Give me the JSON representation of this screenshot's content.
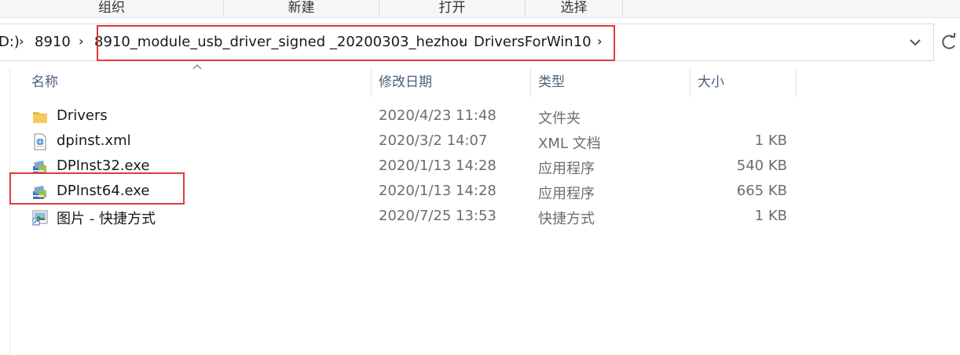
{
  "ribbon": {
    "groups": [
      "组织",
      "新建",
      "打开",
      "选择"
    ]
  },
  "address": {
    "prefix": "D:)",
    "crumbs": [
      "8910",
      "8910_module_usb_driver_signed _20200303_hezhou",
      "DriversForWin10"
    ]
  },
  "columns": {
    "name": "名称",
    "date": "修改日期",
    "type": "类型",
    "size": "大小"
  },
  "files": [
    {
      "name": "Drivers",
      "date": "2020/4/23 11:48",
      "type": "文件夹",
      "size": "",
      "icon": "folder-icon"
    },
    {
      "name": "dpinst.xml",
      "date": "2020/3/2 14:07",
      "type": "XML 文档",
      "size": "1 KB",
      "icon": "xml-document-icon"
    },
    {
      "name": "DPInst32.exe",
      "date": "2020/1/13 14:28",
      "type": "应用程序",
      "size": "540 KB",
      "icon": "installer-app-icon"
    },
    {
      "name": "DPInst64.exe",
      "date": "2020/1/13 14:28",
      "type": "应用程序",
      "size": "665 KB",
      "icon": "installer-app-icon"
    },
    {
      "name": "图片 - 快捷方式",
      "date": "2020/7/25 13:53",
      "type": "快捷方式",
      "size": "1 KB",
      "icon": "shortcut-icon"
    }
  ],
  "colors": {
    "highlight": "#e03a3a",
    "header_text": "#4c607a",
    "secondary_text": "#6d6d6d"
  }
}
